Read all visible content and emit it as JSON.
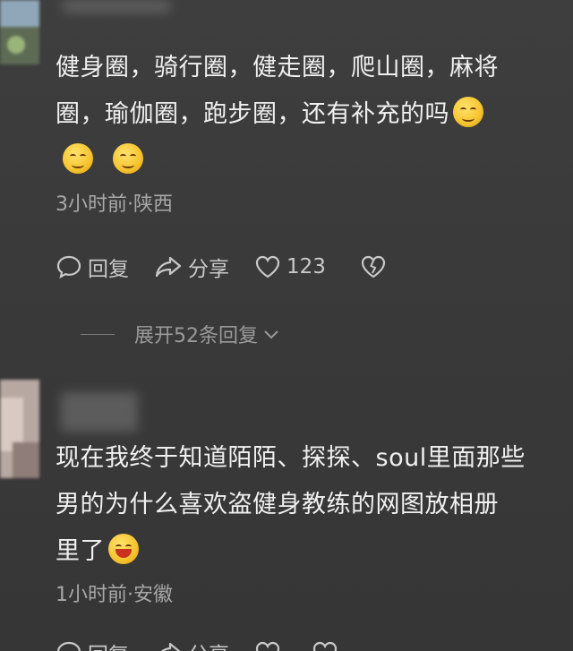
{
  "comments": [
    {
      "text_line1": "健身圈，骑行圈，健走圈，爬山圈，麻将",
      "text_line2": "圈，瑜伽圈，跑步圈，还有补充的吗",
      "time": "3小时前",
      "location": "陕西",
      "separator": "·",
      "reply_label": "回复",
      "share_label": "分享",
      "like_count": "123",
      "expand_label": "展开52条回复"
    },
    {
      "text_line1": "现在我终于知道陌陌、探探、soul里面那些",
      "text_line2": "男的为什么喜欢盗健身教练的网图放相册",
      "text_line3": "里了",
      "time": "1小时前",
      "location": "安徽",
      "separator": "·",
      "reply_label": "回复",
      "share_label": "分享"
    }
  ],
  "icons": {
    "reply": "comment-bubble-icon",
    "share": "share-arrow-icon",
    "like": "heart-icon",
    "dislike": "broken-heart-icon",
    "expand": "chevron-down-icon"
  }
}
